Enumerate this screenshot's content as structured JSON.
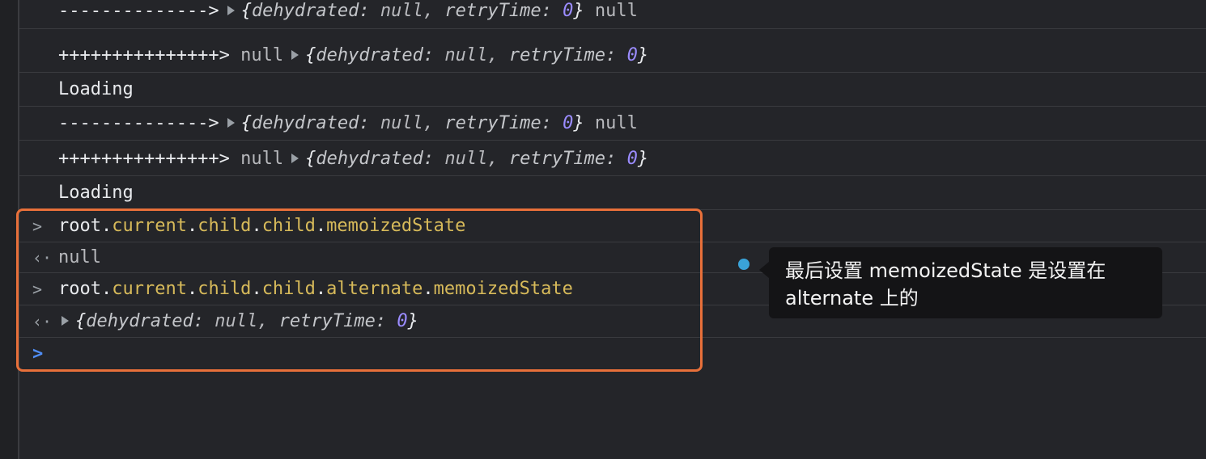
{
  "log_rows": [
    {
      "arrow": "-------------->",
      "obj_open": "{",
      "k1": "dehydrated",
      "v1": "null",
      "k2": "retryTime",
      "v2": "0",
      "obj_close": "}",
      "trail": "null"
    },
    {
      "arrow": "+++++++++++++++>",
      "lead": "null",
      "obj_open": "{",
      "k1": "dehydrated",
      "v1": "null",
      "k2": "retryTime",
      "v2": "0",
      "obj_close": "}"
    },
    {
      "text": "Loading"
    },
    {
      "arrow": "-------------->",
      "obj_open": "{",
      "k1": "dehydrated",
      "v1": "null",
      "k2": "retryTime",
      "v2": "0",
      "obj_close": "}",
      "trail": "null"
    },
    {
      "arrow": "+++++++++++++++>",
      "lead": "null",
      "obj_open": "{",
      "k1": "dehydrated",
      "v1": "null",
      "k2": "retryTime",
      "v2": "0",
      "obj_close": "}"
    },
    {
      "text": "Loading"
    }
  ],
  "commands": [
    {
      "prompt": ">",
      "base": "root",
      "dot": ".",
      "p1": "current",
      "p2": "child",
      "p3": "child",
      "p4": "memoizedState"
    },
    {
      "result_prefix": "‹·",
      "result": "null"
    },
    {
      "prompt": ">",
      "base": "root",
      "dot": ".",
      "p1": "current",
      "p2": "child",
      "p3": "child",
      "p4": "alternate",
      "p5": "memoizedState"
    },
    {
      "result_prefix": "‹·",
      "obj_open": "{",
      "k1": "dehydrated",
      "v1": "null",
      "k2": "retryTime",
      "v2": "0",
      "obj_close": "}"
    }
  ],
  "input_prompt": ">",
  "annotation": {
    "line1": "最后设置 memoizedState 是设置在",
    "line2": "alternate 上的"
  },
  "colors": {
    "background": "#242529",
    "highlight_border": "#e8703a",
    "property": "#d7ba5a",
    "number": "#9b8cff",
    "prompt_blue": "#4f8df5",
    "annotation_dot": "#3aa3d8"
  }
}
